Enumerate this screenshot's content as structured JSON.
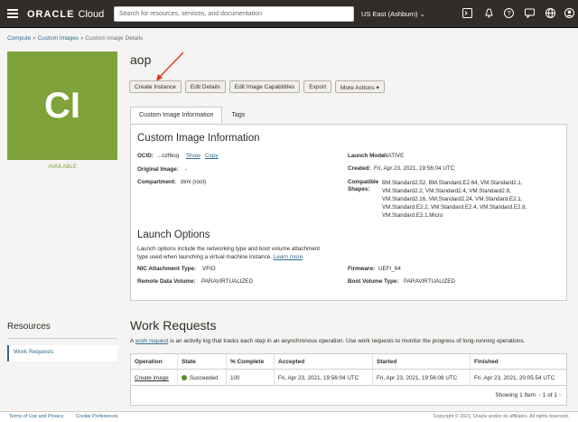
{
  "header": {
    "logo_brand": "ORACLE",
    "logo_product": "Cloud",
    "search_placeholder": "Search for resources, services, and documentation",
    "region": "US East (Ashburn)"
  },
  "breadcrumb": {
    "compute": "Compute",
    "custom_images": "Custom Images",
    "current": "Custom Image Details"
  },
  "image": {
    "initials": "CI",
    "status": "AVAILABLE",
    "name": "aop",
    "status_color": "#7fa33a"
  },
  "actions": {
    "create_instance": "Create Instance",
    "edit_details": "Edit Details",
    "edit_capabilities": "Edit Image Capabilities",
    "export": "Export",
    "more_actions": "More Actions"
  },
  "tabs": {
    "info": "Custom Image Information",
    "tags": "Tags"
  },
  "info": {
    "heading": "Custom Image Information",
    "ocid_label": "OCID:",
    "ocid_value": "...ozf6oq",
    "show": "Show",
    "copy": "Copy",
    "original_image_label": "Original Image:",
    "original_image_value": "-",
    "compartment_label": "Compartment:",
    "compartment_value": "dimi (root)",
    "launch_mode_label": "Launch Mode:",
    "launch_mode_value": "NATIVE",
    "created_label": "Created:",
    "created_value": "Fri, Apr 23, 2021, 19:56:04 UTC",
    "compatible_label": "Compatible",
    "shapes_label": "Shapes:",
    "shapes_lines": [
      "BM.Standard2.52, BM.Standard.E2.64, VM.Standard2.1,",
      "VM.Standard2.2, VM.Standard2.4, VM.Standard2.8,",
      "VM.Standard2.16, VM.Standard2.24, VM.Standard.E2.1,",
      "VM.Standard.E2.2, VM.Standard.E2.4, VM.Standard.E2.8,",
      "VM.Standard.E2.1.Micro"
    ]
  },
  "launch": {
    "heading": "Launch Options",
    "desc_line1": "Launch options include the networking type and boot volume attachment",
    "desc_line2": "type used when launching a virtual machine instance.",
    "learn_more": "Learn more",
    "nic_label": "NIC Attachment Type:",
    "nic_value": "VFIO",
    "remote_label": "Remote Data Volume:",
    "remote_value": "PARAVIRTUALIZED",
    "firmware_label": "Firmware:",
    "firmware_value": "UEFI_64",
    "boot_label": "Boot Volume Type:",
    "boot_value": "PARAVIRTUALIZED"
  },
  "resources": {
    "heading": "Resources",
    "work_requests": "Work Requests"
  },
  "work_requests": {
    "heading": "Work Requests",
    "desc_prefix": "A",
    "desc_link": "work request",
    "desc_suffix": "is an activity log that tracks each step in an asynchronous operation. Use work requests to monitor the progress of long-running operations.",
    "columns": [
      "Operation",
      "State",
      "% Complete",
      "Accepted",
      "Started",
      "Finished"
    ],
    "row": {
      "operation": "Create image",
      "state": "Succeeded",
      "percent": "100",
      "accepted": "Fri, Apr 23, 2021, 19:56:04 UTC",
      "started": "Fri, Apr 23, 2021, 19:56:08 UTC",
      "finished": "Fri, Apr 23, 2021, 20:05:54 UTC"
    },
    "showing": "Showing 1 Item",
    "page": "1 of 1"
  },
  "footer": {
    "terms": "Terms of Use and Privacy",
    "cookies": "Cookie Preferences",
    "copyright": "Copyright © 2021, Oracle and/or its affiliates. All rights reserved."
  }
}
